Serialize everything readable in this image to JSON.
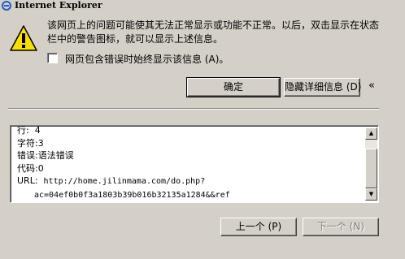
{
  "window": {
    "title": "Internet Explorer"
  },
  "message": {
    "line1": "该网页上的问题可能使其无法正常显示或功能不正常。以后，双击显示在状态",
    "line2": "栏中的警告图标，就可以显示上述信息。"
  },
  "checkbox": {
    "label": "网页包含错误时始终显示该信息 (A)。",
    "checked": false
  },
  "buttons": {
    "ok": "确定",
    "hide_details": "隐藏详细信息 (D)",
    "chevron": "«",
    "prev": "上一个 (P)",
    "next": "下一个 (N)"
  },
  "details": {
    "line_partial": "行:  4",
    "char": "字符:3",
    "error": "错误:语法错误",
    "code": "代码:0",
    "url_label": "URL:",
    "url_1": "http://home.jilinmama.com/do.php?",
    "url_2": "ac=04ef0b0f3a1803b39b016b32135a1284&&ref"
  },
  "colors": {
    "face": "#d4d0c8",
    "shadow": "#808080",
    "highlight": "#ffffff",
    "warning_yellow": "#f8e000"
  },
  "icons": [
    "ie-logo-icon",
    "warning-icon",
    "chevron-left-double-icon",
    "scroll-up-icon",
    "scroll-down-icon"
  ]
}
